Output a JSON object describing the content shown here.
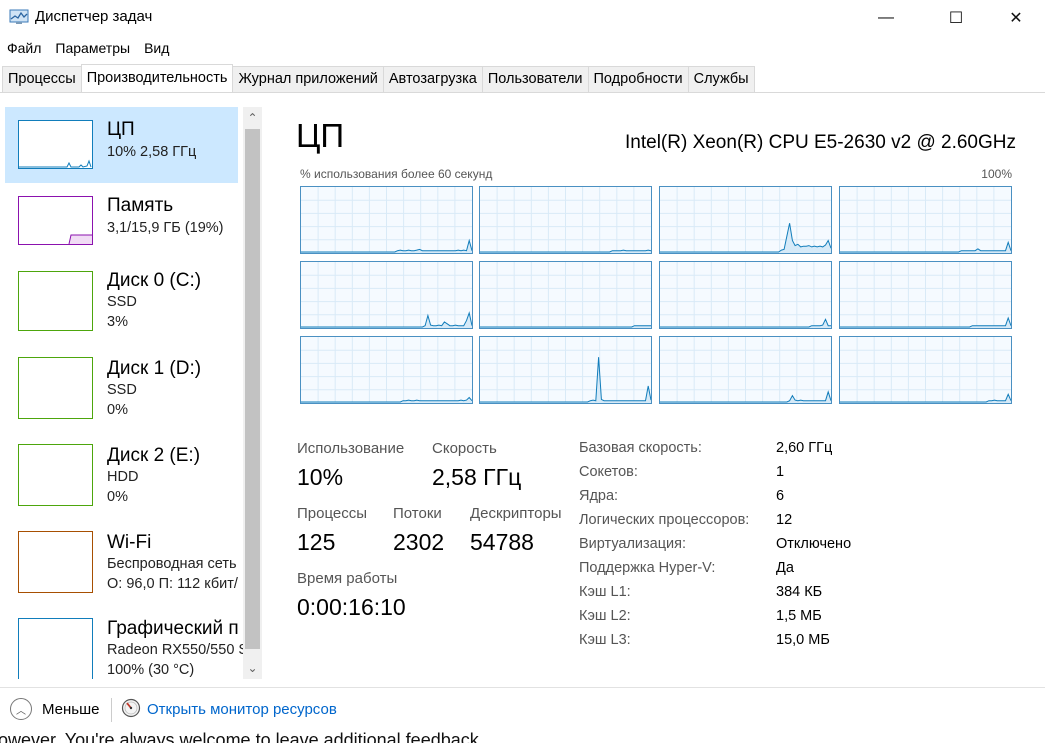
{
  "window": {
    "title": "Диспетчер задач",
    "min_glyph": "—",
    "max_glyph": "☐",
    "close_glyph": "✕"
  },
  "menu": [
    "Файл",
    "Параметры",
    "Вид"
  ],
  "tabs": [
    {
      "label": "Процессы",
      "active": false
    },
    {
      "label": "Производительность",
      "active": true
    },
    {
      "label": "Журнал приложений",
      "active": false
    },
    {
      "label": "Автозагрузка",
      "active": false
    },
    {
      "label": "Пользователи",
      "active": false
    },
    {
      "label": "Подробности",
      "active": false
    },
    {
      "label": "Службы",
      "active": false
    }
  ],
  "sidebar": {
    "items": [
      {
        "title": "ЦП",
        "lines": [
          "10%  2,58 ГГц"
        ],
        "color": "#117dbb",
        "selected": true
      },
      {
        "title": "Память",
        "lines": [
          "3,1/15,9 ГБ (19%)"
        ],
        "color": "#8b12ae",
        "selected": false
      },
      {
        "title": "Диск 0 (C:)",
        "lines": [
          "SSD",
          "3%"
        ],
        "color": "#4da60c",
        "selected": false
      },
      {
        "title": "Диск 1 (D:)",
        "lines": [
          "SSD",
          "0%"
        ],
        "color": "#4da60c",
        "selected": false
      },
      {
        "title": "Диск 2 (E:)",
        "lines": [
          "HDD",
          "0%"
        ],
        "color": "#4da60c",
        "selected": false
      },
      {
        "title": "Wi-Fi",
        "lines": [
          "Беспроводная сеть",
          "О: 96,0  П: 112 кбит/"
        ],
        "color": "#a74f01",
        "selected": false
      },
      {
        "title": "Графический п",
        "lines": [
          "Radeon RX550/550 S",
          "100%  (30 °C)"
        ],
        "color": "#117dbb",
        "selected": false
      }
    ],
    "scroll_up": "⌃",
    "scroll_down": "⌄"
  },
  "main": {
    "heading": "ЦП",
    "model": "Intel(R) Xeon(R) CPU E5-2630 v2 @ 2.60GHz",
    "graph_caption": "% использования более 60 секунд",
    "graph_max": "100%",
    "stats": {
      "usage_label": "Использование",
      "usage_value": "10%",
      "speed_label": "Скорость",
      "speed_value": "2,58 ГГц",
      "processes_label": "Процессы",
      "processes_value": "125",
      "threads_label": "Потоки",
      "threads_value": "2302",
      "handles_label": "Дескрипторы",
      "handles_value": "54788",
      "uptime_label": "Время работы",
      "uptime_value": "0:00:16:10"
    },
    "info": [
      {
        "label": "Базовая скорость:",
        "value": "2,60 ГГц"
      },
      {
        "label": "Сокетов:",
        "value": "1"
      },
      {
        "label": "Ядра:",
        "value": "6"
      },
      {
        "label": "Логических процессоров:",
        "value": "12"
      },
      {
        "label": "Виртуализация:",
        "value": "Отключено"
      },
      {
        "label": "Поддержка Hyper-V:",
        "value": "Да"
      },
      {
        "label": "Кэш L1:",
        "value": "384 КБ"
      },
      {
        "label": "Кэш L2:",
        "value": "1,5 МБ"
      },
      {
        "label": "Кэш L3:",
        "value": "15,0 МБ"
      }
    ],
    "core_graphs": [
      [
        0,
        0,
        0,
        0,
        0,
        0,
        0,
        0,
        0,
        0,
        0,
        0,
        0,
        0,
        0,
        0,
        0,
        0,
        0,
        0,
        0,
        0,
        0,
        0,
        0,
        0,
        0,
        0,
        0,
        0,
        0,
        0,
        0,
        0,
        0,
        2,
        3,
        2,
        2,
        3,
        2,
        2,
        3,
        4,
        2,
        2,
        2,
        2,
        2,
        2,
        2,
        2,
        2,
        2,
        2,
        2,
        2,
        3,
        2,
        3,
        2,
        18,
        2
      ],
      [
        0,
        0,
        0,
        0,
        0,
        0,
        0,
        0,
        0,
        0,
        0,
        0,
        0,
        0,
        0,
        0,
        0,
        0,
        0,
        0,
        0,
        0,
        0,
        0,
        0,
        0,
        0,
        0,
        0,
        0,
        0,
        0,
        0,
        0,
        0,
        0,
        0,
        0,
        0,
        0,
        0,
        0,
        0,
        0,
        0,
        0,
        0,
        0,
        2,
        2,
        2,
        2,
        3,
        2,
        2,
        2,
        2,
        2,
        2,
        2,
        2,
        3,
        2
      ],
      [
        0,
        0,
        0,
        0,
        0,
        0,
        0,
        0,
        0,
        0,
        0,
        0,
        0,
        0,
        0,
        0,
        0,
        0,
        0,
        0,
        0,
        0,
        0,
        0,
        0,
        0,
        0,
        0,
        0,
        0,
        0,
        0,
        0,
        0,
        0,
        0,
        0,
        0,
        0,
        0,
        0,
        0,
        0,
        0,
        3,
        4,
        25,
        45,
        18,
        10,
        12,
        8,
        9,
        9,
        10,
        8,
        9,
        8,
        9,
        8,
        11,
        18,
        6
      ],
      [
        0,
        0,
        0,
        0,
        0,
        0,
        0,
        0,
        0,
        0,
        0,
        0,
        0,
        0,
        0,
        0,
        0,
        0,
        0,
        0,
        0,
        0,
        0,
        0,
        0,
        0,
        0,
        0,
        0,
        0,
        0,
        0,
        0,
        0,
        0,
        0,
        0,
        0,
        0,
        0,
        0,
        0,
        0,
        0,
        2,
        2,
        2,
        2,
        2,
        2,
        5,
        2,
        2,
        2,
        2,
        2,
        2,
        2,
        2,
        2,
        2,
        15,
        2
      ],
      [
        0,
        0,
        0,
        0,
        0,
        0,
        0,
        0,
        0,
        0,
        0,
        0,
        0,
        0,
        0,
        0,
        0,
        0,
        0,
        0,
        0,
        0,
        0,
        0,
        0,
        0,
        0,
        0,
        0,
        0,
        0,
        0,
        0,
        0,
        0,
        0,
        0,
        0,
        0,
        0,
        0,
        0,
        0,
        0,
        0,
        2,
        18,
        3,
        2,
        2,
        3,
        2,
        8,
        5,
        2,
        2,
        3,
        2,
        2,
        2,
        10,
        22,
        2
      ],
      [
        0,
        0,
        0,
        0,
        0,
        0,
        0,
        0,
        0,
        0,
        0,
        0,
        0,
        0,
        0,
        0,
        0,
        0,
        0,
        0,
        0,
        0,
        0,
        0,
        0,
        0,
        0,
        0,
        0,
        0,
        0,
        0,
        0,
        0,
        0,
        0,
        0,
        0,
        0,
        0,
        0,
        0,
        0,
        0,
        0,
        0,
        0,
        0,
        0,
        0,
        0,
        0,
        0,
        0,
        0,
        0,
        2,
        2,
        2,
        2,
        2,
        2,
        2
      ],
      [
        0,
        0,
        0,
        0,
        0,
        0,
        0,
        0,
        0,
        0,
        0,
        0,
        0,
        0,
        0,
        0,
        0,
        0,
        0,
        0,
        0,
        0,
        0,
        0,
        0,
        0,
        0,
        0,
        0,
        0,
        0,
        0,
        0,
        0,
        0,
        0,
        0,
        0,
        0,
        0,
        0,
        0,
        0,
        0,
        0,
        0,
        0,
        0,
        0,
        0,
        0,
        0,
        0,
        0,
        0,
        2,
        2,
        2,
        2,
        3,
        12,
        2,
        2
      ],
      [
        0,
        0,
        0,
        0,
        0,
        0,
        0,
        0,
        0,
        0,
        0,
        0,
        0,
        0,
        0,
        0,
        0,
        0,
        0,
        0,
        0,
        0,
        0,
        0,
        0,
        0,
        0,
        0,
        0,
        0,
        0,
        0,
        0,
        0,
        0,
        0,
        0,
        0,
        0,
        0,
        0,
        0,
        0,
        0,
        0,
        0,
        0,
        0,
        2,
        2,
        2,
        2,
        2,
        2,
        2,
        2,
        2,
        2,
        2,
        2,
        2,
        14,
        2
      ],
      [
        0,
        0,
        0,
        0,
        0,
        0,
        0,
        0,
        0,
        0,
        0,
        0,
        0,
        0,
        0,
        0,
        0,
        0,
        0,
        0,
        0,
        0,
        0,
        0,
        0,
        0,
        0,
        0,
        0,
        0,
        0,
        0,
        0,
        0,
        0,
        0,
        0,
        2,
        2,
        3,
        2,
        2,
        3,
        2,
        2,
        2,
        2,
        2,
        2,
        2,
        2,
        2,
        2,
        2,
        2,
        2,
        2,
        2,
        3,
        2,
        3,
        7,
        2
      ],
      [
        0,
        0,
        0,
        0,
        0,
        0,
        0,
        0,
        0,
        0,
        0,
        0,
        0,
        0,
        0,
        0,
        0,
        0,
        0,
        0,
        0,
        0,
        0,
        0,
        0,
        0,
        0,
        0,
        0,
        0,
        0,
        0,
        0,
        0,
        0,
        0,
        0,
        0,
        0,
        0,
        2,
        3,
        2,
        70,
        4,
        2,
        2,
        2,
        2,
        2,
        2,
        2,
        2,
        2,
        2,
        2,
        2,
        2,
        2,
        2,
        2,
        25,
        3
      ],
      [
        0,
        0,
        0,
        0,
        0,
        0,
        0,
        0,
        0,
        0,
        0,
        0,
        0,
        0,
        0,
        0,
        0,
        0,
        0,
        0,
        0,
        0,
        0,
        0,
        0,
        0,
        0,
        0,
        0,
        0,
        0,
        0,
        0,
        0,
        0,
        0,
        0,
        0,
        0,
        0,
        0,
        0,
        0,
        0,
        0,
        0,
        0,
        2,
        10,
        3,
        2,
        3,
        2,
        2,
        2,
        2,
        2,
        2,
        2,
        2,
        2,
        16,
        2
      ],
      [
        0,
        0,
        0,
        0,
        0,
        0,
        0,
        0,
        0,
        0,
        0,
        0,
        0,
        0,
        0,
        0,
        0,
        0,
        0,
        0,
        0,
        0,
        0,
        0,
        0,
        0,
        0,
        0,
        0,
        0,
        0,
        0,
        0,
        0,
        0,
        0,
        0,
        0,
        0,
        0,
        0,
        0,
        0,
        0,
        0,
        0,
        0,
        0,
        0,
        0,
        0,
        0,
        0,
        0,
        2,
        2,
        3,
        2,
        2,
        2,
        2,
        12,
        2
      ]
    ]
  },
  "bottom": {
    "fewer_label": "Меньше",
    "fewer_icon": "︿",
    "monitor_link": "Открыть монитор ресурсов"
  },
  "underlying_text": "owever. You're always welcome to leave additional feedback."
}
